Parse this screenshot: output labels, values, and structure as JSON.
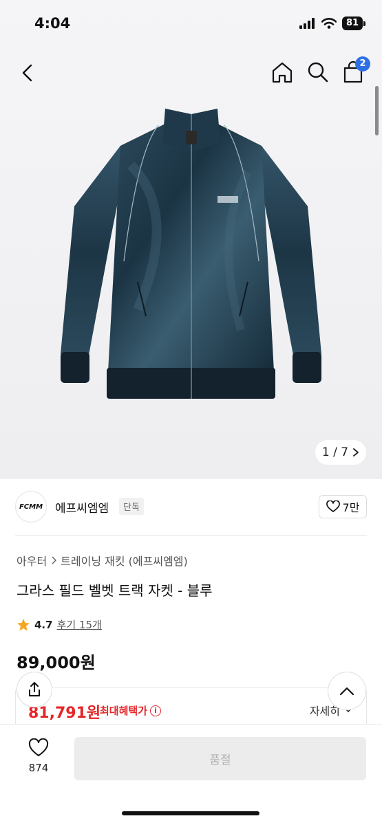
{
  "status": {
    "time": "4:04",
    "battery": "81"
  },
  "nav": {
    "cart_count": "2",
    "back_icon": "chevron-left-icon",
    "home_icon": "home-icon",
    "search_icon": "search-icon",
    "cart_icon": "cart-icon"
  },
  "gallery": {
    "counter": "1 / 7"
  },
  "brand": {
    "logo_text": "FCMM",
    "name": "에프씨엠엠",
    "tag": "단독",
    "likes": "7만"
  },
  "product": {
    "breadcrumb": [
      "아우터",
      "트레이닝 재킷 (에프씨엠엠)"
    ],
    "title": "그라스 필드 벨벳 트랙 자켓 - 블루",
    "rating": "4.7",
    "reviews": "후기 15개",
    "price": "89,000원"
  },
  "benefit": {
    "sale_price": "81,791원",
    "label": "최대혜택가",
    "details": "자세히"
  },
  "bottom": {
    "wish_count": "874",
    "buy_label": "품절"
  },
  "colors": {
    "accent": "#e52528",
    "badge": "#2f6fe4",
    "jacket": "#1f3a4b"
  }
}
